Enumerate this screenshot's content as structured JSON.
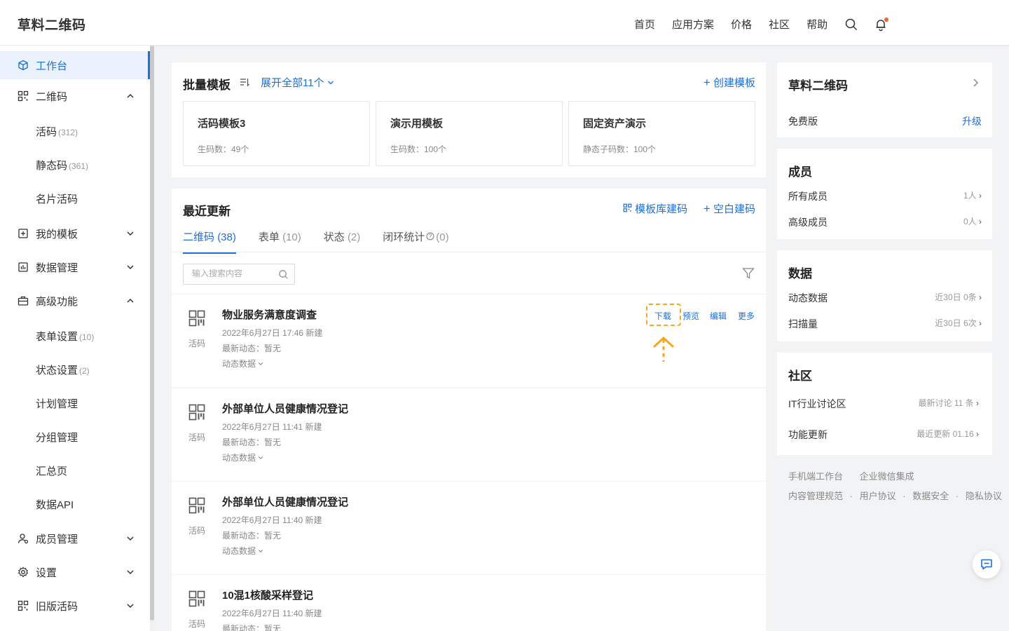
{
  "header": {
    "logo": "草料二维码",
    "nav": [
      "首页",
      "应用方案",
      "价格",
      "社区",
      "帮助"
    ],
    "icons": [
      "search-icon",
      "bell-icon"
    ]
  },
  "sidebar": {
    "workbench": "工作台",
    "qrcode": "二维码",
    "live_code": "活码",
    "live_code_count": "(312)",
    "static_code": "静态码",
    "static_code_count": "(361)",
    "card_code": "名片活码",
    "my_templates": "我的模板",
    "data_mgmt": "数据管理",
    "advanced": "高级功能",
    "form_settings": "表单设置",
    "form_settings_count": "(10)",
    "status_settings": "状态设置",
    "status_settings_count": "(2)",
    "plan_mgmt": "计划管理",
    "group_mgmt": "分组管理",
    "summary": "汇总页",
    "data_api": "数据API",
    "member_mgmt": "成员管理",
    "settings": "设置",
    "old_live_code": "旧版活码"
  },
  "batch": {
    "title": "批量模板",
    "expand": "展开全部11个",
    "create": "创建模板",
    "templates": [
      {
        "title": "活码模板3",
        "sub": "生码数：49个"
      },
      {
        "title": "演示用模板",
        "sub": "生码数：100个"
      },
      {
        "title": "固定资产演示",
        "sub": "静态子码数：100个"
      }
    ]
  },
  "recent": {
    "title": "最近更新",
    "from_library": "模板库建码",
    "blank": "空白建码",
    "tabs": [
      {
        "label": "二维码",
        "count": "(38)"
      },
      {
        "label": "表单",
        "count": "(10)"
      },
      {
        "label": "状态",
        "count": "(2)"
      },
      {
        "label": "闭环统计",
        "count": "(0)"
      }
    ],
    "search_placeholder": "输入搜索内容",
    "actions": {
      "download": "下载",
      "preview": "预览",
      "edit": "编辑",
      "more": "更多"
    },
    "items": [
      {
        "tag": "活码",
        "title": "物业服务满意度调查",
        "created": "2022年6月27日 17:46 新建",
        "latest": "最新动态：暂无",
        "dynamic": "动态数据"
      },
      {
        "tag": "活码",
        "title": "外部单位人员健康情况登记",
        "created": "2022年6月27日 11:41 新建",
        "latest": "最新动态：暂无",
        "dynamic": "动态数据"
      },
      {
        "tag": "活码",
        "title": "外部单位人员健康情况登记",
        "created": "2022年6月27日 11:40 新建",
        "latest": "最新动态：暂无",
        "dynamic": "动态数据"
      },
      {
        "tag": "活码",
        "title": "10混1核酸采样登记",
        "created": "2022年6月27日 11:40 新建",
        "latest": "最新动态：暂无",
        "dynamic": "动态数据"
      }
    ]
  },
  "account": {
    "title": "草料二维码",
    "plan": "免费版",
    "upgrade": "升级"
  },
  "members": {
    "title": "成员",
    "all": "所有成员",
    "all_count": "1人",
    "senior": "高级成员",
    "senior_count": "0人"
  },
  "data": {
    "title": "数据",
    "dynamic": "动态数据",
    "dynamic_val": "近30日  0条",
    "scans": "扫描量",
    "scans_val": "近30日  6次"
  },
  "community": {
    "title": "社区",
    "it": "IT行业讨论区",
    "it_val": "最新讨论 11 条",
    "updates": "功能更新",
    "updates_val": "最近更新 01.16"
  },
  "footer": {
    "line1": [
      "手机端工作台",
      "企业微信集成"
    ],
    "line2": [
      "内容管理规范",
      "用户协议",
      "数据安全",
      "隐私协议"
    ],
    "sep": "·"
  },
  "colors": {
    "accent": "#1f6fd6",
    "highlight": "#f5a623"
  }
}
